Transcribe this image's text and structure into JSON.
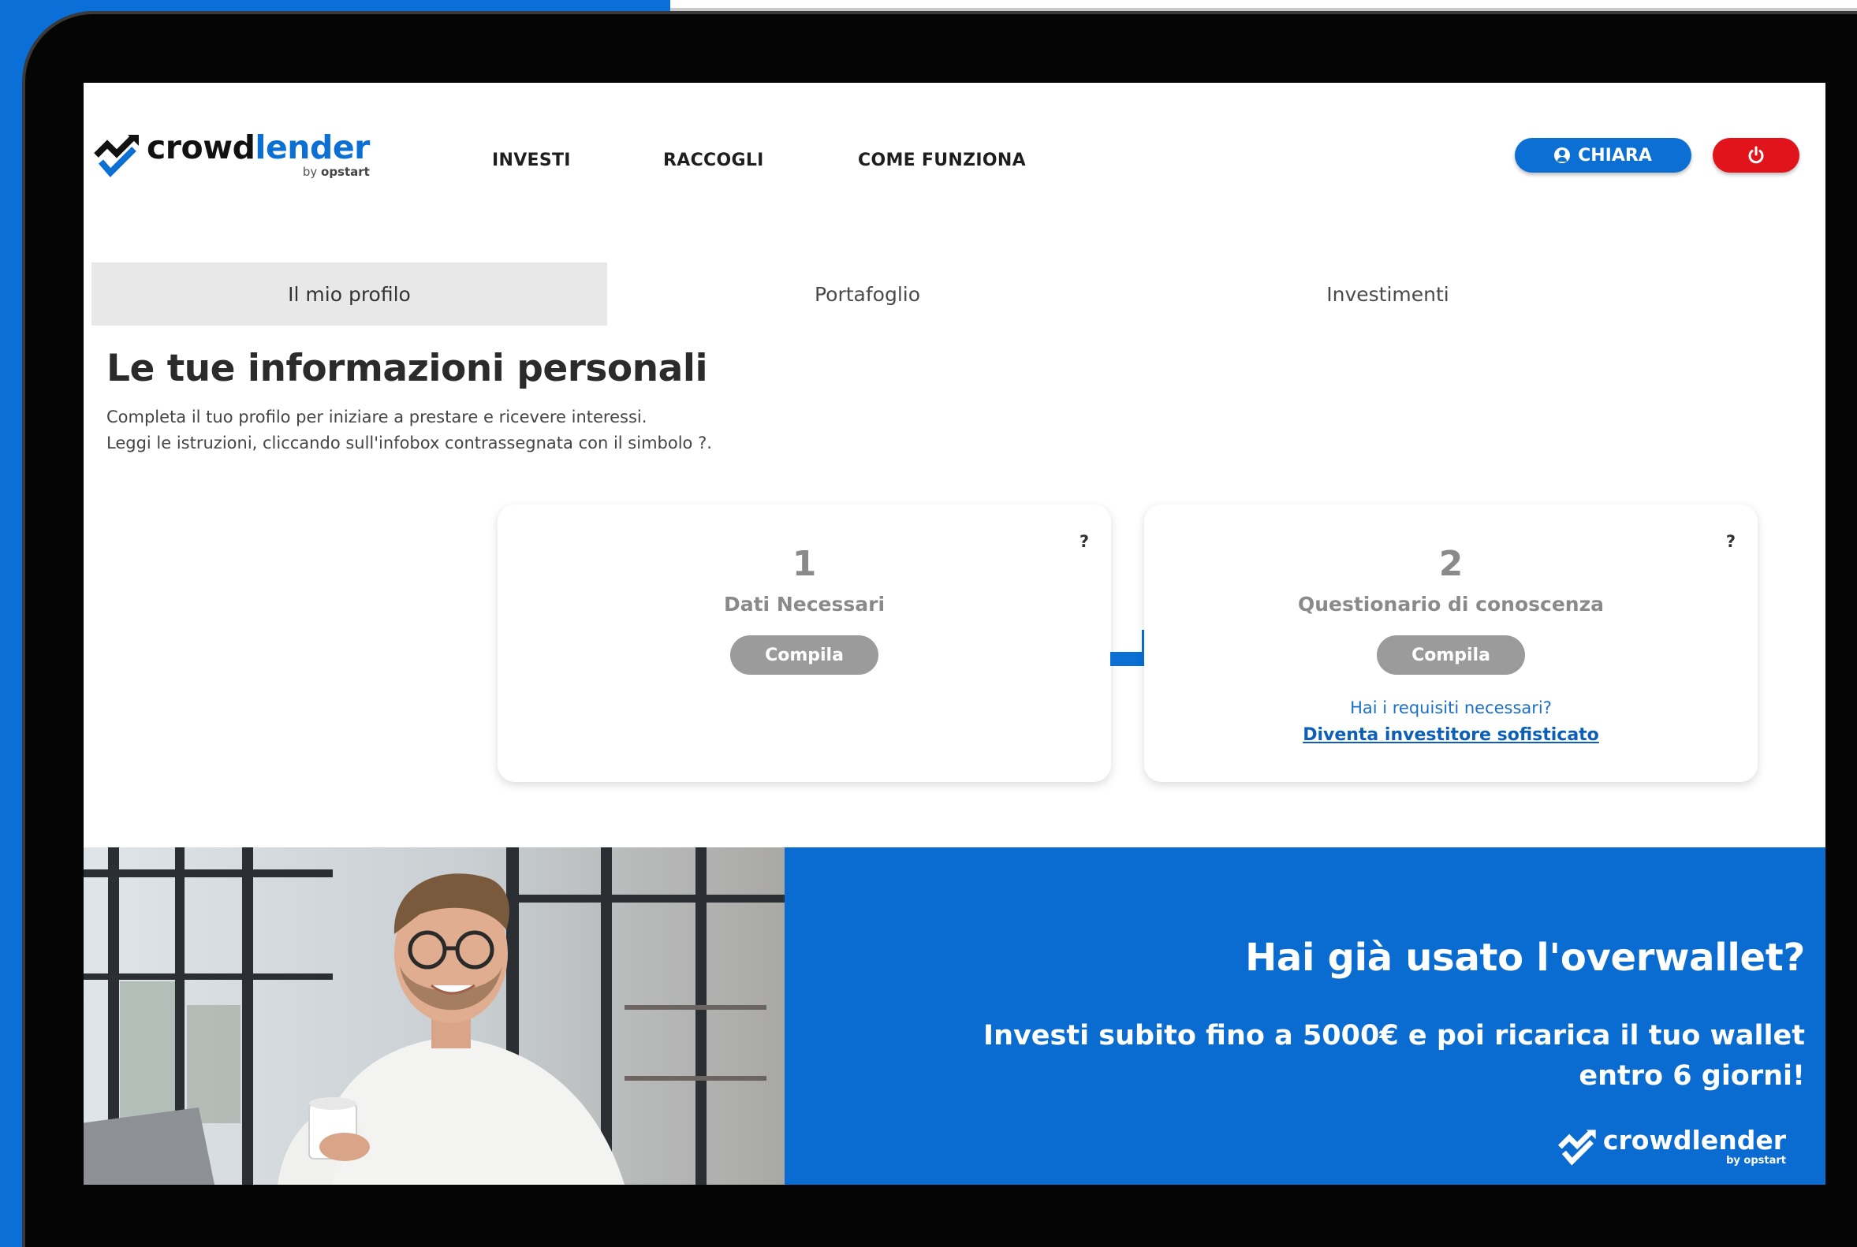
{
  "brand": {
    "name_part1": "crowd",
    "name_part2": "lender",
    "by_prefix": "by",
    "by_name": "opstart",
    "primary_color": "#0b6fd3",
    "danger_color": "#e2141b"
  },
  "nav": {
    "items": [
      {
        "label": "INVESTI"
      },
      {
        "label": "RACCOGLI"
      },
      {
        "label": "COME FUNZIONA"
      }
    ]
  },
  "header": {
    "user_label": "CHIARA",
    "user_icon": "user-circle-icon",
    "logout_icon": "power-icon"
  },
  "tabs": [
    {
      "label": "Il mio profilo",
      "active": true
    },
    {
      "label": "Portafoglio",
      "active": false
    },
    {
      "label": "Investimenti",
      "active": false
    }
  ],
  "main": {
    "title": "Le tue informazioni personali",
    "subtitle_line1": "Completa il tuo profilo per iniziare a prestare e ricevere interessi.",
    "subtitle_line2": "Leggi le istruzioni, cliccando sull'infobox contrassegnata con il simbolo ?."
  },
  "steps": [
    {
      "number": "1",
      "title": "Dati Necessari",
      "button": "Compila",
      "help": "?"
    },
    {
      "number": "2",
      "title": "Questionario di conoscenza",
      "button": "Compila",
      "help": "?",
      "requirement_question": "Hai i requisiti necessari?",
      "requirement_link": "Diventa investitore sofisticato"
    }
  ],
  "banner": {
    "heading": "Hai già usato l'overwallet?",
    "subtext": "Investi subito fino a 5000€ e poi ricarica il tuo wallet entro 6 giorni!",
    "logo_word": "crowdlender",
    "logo_by": "by opstart"
  }
}
